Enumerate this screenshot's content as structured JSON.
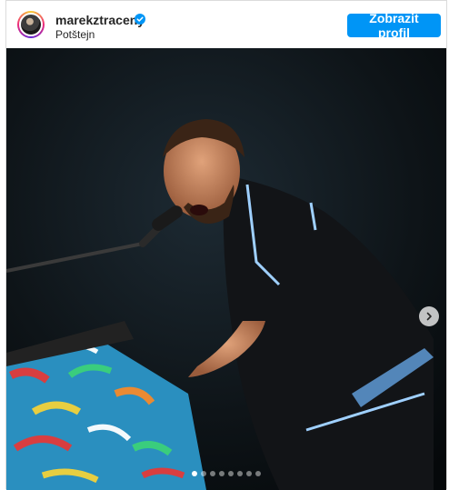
{
  "post": {
    "username": "marekztraceny",
    "location": "Potštejn",
    "profile_button_label": "Zobrazit profil",
    "accent_color": "#0095f6",
    "verified_icon": "verified-badge-icon"
  },
  "carousel": {
    "current_index": 1,
    "total": 8,
    "next_icon": "chevron-right-icon"
  },
  "photo": {
    "description_icon": "concert-photo"
  }
}
